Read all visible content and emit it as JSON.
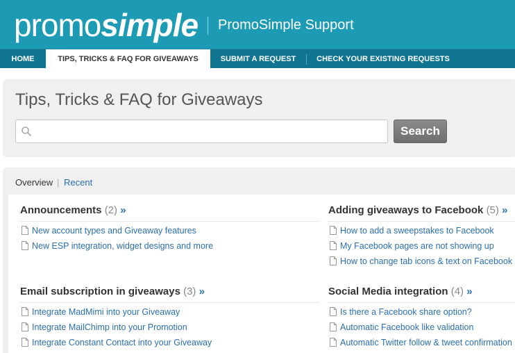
{
  "header": {
    "logo_part1": "promo",
    "logo_part2": "simple",
    "site_title": "PromoSimple Support"
  },
  "nav": {
    "items": [
      {
        "label": "HOME"
      },
      {
        "label": "TIPS, TRICKS & FAQ FOR GIVEAWAYS"
      },
      {
        "label": "SUBMIT A REQUEST"
      },
      {
        "label": "CHECK YOUR EXISTING REQUESTS"
      }
    ],
    "active_index": 1
  },
  "search": {
    "page_title": "Tips, Tricks & FAQ for Giveaways",
    "placeholder": "",
    "value": "",
    "button_label": "Search"
  },
  "tabs": {
    "overview": "Overview",
    "separator": "|",
    "recent": "Recent"
  },
  "categories": [
    {
      "title": "Announcements",
      "count": "(2)",
      "more": "»",
      "articles": [
        "New account types and Giveaway features",
        "New ESP integration, widget designs and more"
      ]
    },
    {
      "title": "Adding giveaways to Facebook",
      "count": "(5)",
      "more": "»",
      "articles": [
        "How to add a sweepstakes to Facebook",
        "My Facebook pages are not showing up",
        "How to change tab icons & text on Facebook"
      ]
    },
    {
      "title": "Email subscription in giveaways",
      "count": "(3)",
      "more": "»",
      "articles": [
        "Integrate MadMimi into your Giveaway",
        "Integrate MailChimp into your Promotion",
        "Integrate Constant Contact into your Giveaway"
      ]
    },
    {
      "title": "Social Media integration",
      "count": "(4)",
      "more": "»",
      "articles": [
        "Is there a Facebook share option?",
        "Automatic Facebook like validation",
        "Automatic Twitter follow & tweet confirmation"
      ]
    }
  ],
  "colors": {
    "header_bg": "#1d9bb5",
    "nav_bg": "#0f7591",
    "link": "#2a6fb0",
    "panel_bg": "#f0f0f0"
  },
  "icons": {
    "search": "search-icon",
    "article": "document-icon"
  }
}
